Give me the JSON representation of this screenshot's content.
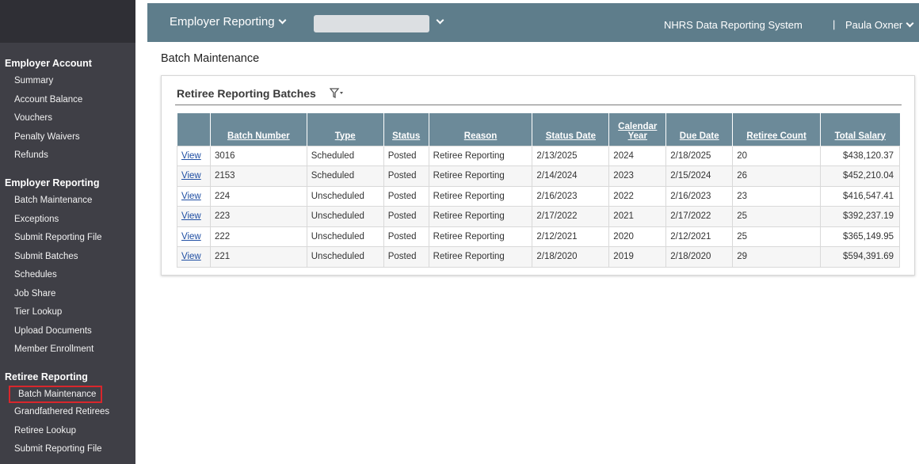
{
  "sidebar": {
    "employer_account": {
      "heading": "Employer Account",
      "items": [
        "Summary",
        "Account Balance",
        "Vouchers",
        "Penalty Waivers",
        "Refunds"
      ]
    },
    "employer_reporting": {
      "heading": "Employer Reporting",
      "items": [
        "Batch Maintenance",
        "Exceptions",
        "Submit Reporting File",
        "Submit Batches",
        "Schedules",
        "Job Share",
        "Tier Lookup",
        "Upload Documents",
        "Member Enrollment"
      ]
    },
    "retiree_reporting": {
      "heading": "Retiree Reporting",
      "items": [
        "Batch Maintenance",
        "Grandfathered Retirees",
        "Retiree Lookup",
        "Submit Reporting File"
      ],
      "selected": "Batch Maintenance"
    }
  },
  "topbar": {
    "menu_label": "Employer Reporting",
    "system_name": "NHRS Data Reporting System",
    "separator": "|",
    "user_name": "Paula Oxner",
    "bar_color": "#5e7d8b"
  },
  "page": {
    "title": "Batch Maintenance"
  },
  "panel": {
    "title": "Retiree Reporting Batches",
    "filter_icon": "filter-icon"
  },
  "table": {
    "columns": [
      "",
      "Batch Number",
      "Type",
      "Status",
      "Reason",
      "Status Date",
      "Calendar Year",
      "Due Date",
      "Retiree Count",
      "Total Salary"
    ],
    "rows": [
      [
        "View",
        "3016",
        "Scheduled",
        "Posted",
        "Retiree Reporting",
        "2/13/2025",
        "2024",
        "2/18/2025",
        "20",
        "$438,120.37"
      ],
      [
        "View",
        "2153",
        "Scheduled",
        "Posted",
        "Retiree Reporting",
        "2/14/2024",
        "2023",
        "2/15/2024",
        "26",
        "$452,210.04"
      ],
      [
        "View",
        "224",
        "Unscheduled",
        "Posted",
        "Retiree Reporting",
        "2/16/2023",
        "2022",
        "2/16/2023",
        "23",
        "$416,547.41"
      ],
      [
        "View",
        "223",
        "Unscheduled",
        "Posted",
        "Retiree Reporting",
        "2/17/2022",
        "2021",
        "2/17/2022",
        "25",
        "$392,237.19"
      ],
      [
        "View",
        "222",
        "Unscheduled",
        "Posted",
        "Retiree Reporting",
        "2/12/2021",
        "2020",
        "2/12/2021",
        "25",
        "$365,149.95"
      ],
      [
        "View",
        "221",
        "Unscheduled",
        "Posted",
        "Retiree Reporting",
        "2/18/2020",
        "2019",
        "2/18/2020",
        "29",
        "$594,391.69"
      ]
    ],
    "header_color": "#6c8a99",
    "link_color": "#1f4ea3"
  }
}
